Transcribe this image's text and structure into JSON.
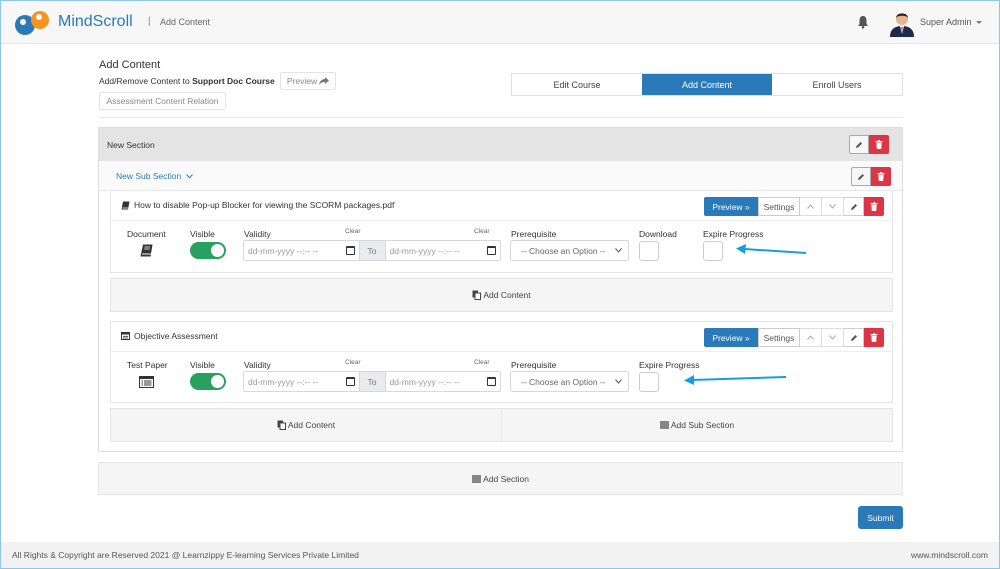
{
  "header": {
    "brand": "MindScroll",
    "separator": "|",
    "breadcrumb": "Add Content",
    "user_name": "Super Admin",
    "icons": {
      "notifications": "bell-icon",
      "user": "avatar",
      "menu": "caret-down-icon"
    }
  },
  "page": {
    "title": "Add Content",
    "subtitle_prefix": "Add/Remove Content to ",
    "course_name": "Support Doc Course",
    "preview_label": "Preview",
    "assessment_relation_label": "Assessment Content Relation"
  },
  "tabs": [
    {
      "label": "Edit Course",
      "active": false
    },
    {
      "label": "Add Content",
      "active": true
    },
    {
      "label": "Enroll Users",
      "active": false
    }
  ],
  "section": {
    "title": "New Section",
    "sub_section": {
      "title": "New Sub Section",
      "items": [
        {
          "title": "How to disable Pop-up Blocker for viewing the SCORM packages.pdf",
          "type_label": "Document",
          "icon": "book-icon",
          "visible_label": "Visible",
          "visible": true,
          "validity_label": "Validity",
          "clear_label": "Clear",
          "from_placeholder": "dd-mm-yyyy --:-- --",
          "to_label": "To",
          "to_placeholder": "dd-mm-yyyy --:-- --",
          "prerequisite_label": "Prerequisite",
          "prerequisite_value": "-- Choose an Option --",
          "download_label": "Download",
          "download_checked": false,
          "expire_label": "Expire Progress",
          "expire_checked": false,
          "preview_label": "Preview »",
          "settings_label": "Settings"
        },
        {
          "title": "Objective Assessment",
          "type_label": "Test Paper",
          "icon": "list-alt-icon",
          "visible_label": "Visible",
          "visible": true,
          "validity_label": "Validity",
          "clear_label": "Clear",
          "from_placeholder": "dd-mm-yyyy --:-- --",
          "to_label": "To",
          "to_placeholder": "dd-mm-yyyy --:-- --",
          "prerequisite_label": "Prerequisite",
          "prerequisite_value": "-- Choose an Option --",
          "expire_label": "Expire Progress",
          "expire_checked": false,
          "preview_label": "Preview »",
          "settings_label": "Settings"
        }
      ],
      "add_content_label": "Add Content",
      "add_content_label_2": "Add Content",
      "add_sub_section_label": "Add Sub Section"
    }
  },
  "add_section_label": "Add Section",
  "submit_label": "Submit",
  "footer": {
    "copyright": "All Rights & Copyright are Reserved 2021 @ Learnzippy E-learning Services Private Limited",
    "website": "www.mindscroll.com"
  },
  "colors": {
    "primary": "#2a7ab9",
    "danger": "#dc3545",
    "toggle_on": "#28a060",
    "annotation_arrow": "#1a9be0"
  }
}
